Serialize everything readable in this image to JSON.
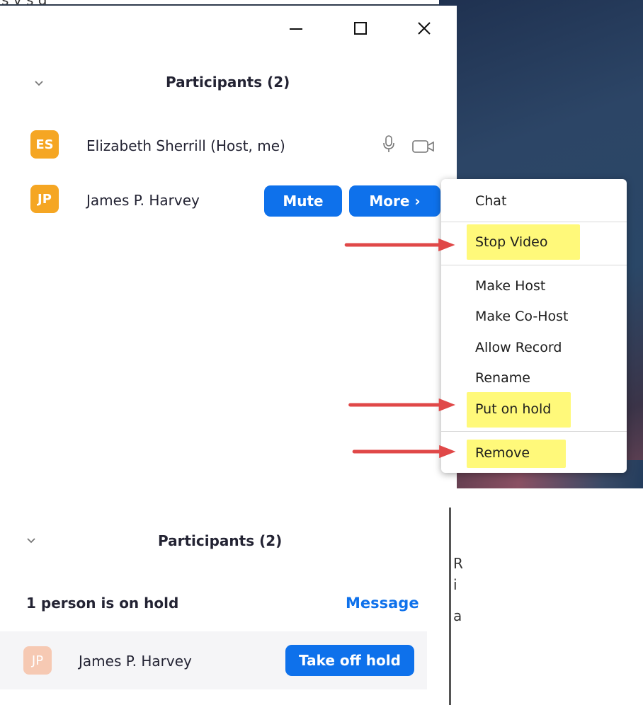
{
  "caption_fragment": "s   y  s  g",
  "window_controls": {
    "minimize_glyph": "—",
    "maximize_glyph": "☐",
    "close_glyph": "✕"
  },
  "participants_panel": {
    "title": "Participants (2)",
    "participants": [
      {
        "initials": "ES",
        "name": "Elizabeth Sherrill (Host, me)",
        "avatar_color": "#f5a623",
        "icons": [
          "microphone-icon",
          "video-camera-icon"
        ]
      },
      {
        "initials": "JP",
        "name": "James P. Harvey",
        "avatar_color": "#f5a623",
        "mute_label": "Mute",
        "more_label": "More ›"
      }
    ]
  },
  "context_menu": {
    "items": [
      {
        "label": "Chat",
        "highlighted": false
      },
      {
        "label": "Stop Video",
        "highlighted": true
      },
      {
        "label": "Make Host",
        "highlighted": false
      },
      {
        "label": "Make Co-Host",
        "highlighted": false
      },
      {
        "label": "Allow Record",
        "highlighted": false
      },
      {
        "label": "Rename",
        "highlighted": false
      },
      {
        "label": "Put on hold",
        "highlighted": true
      },
      {
        "label": "Remove",
        "highlighted": true
      }
    ],
    "highlight_color": "#fff97a",
    "arrow_color": "#e04848"
  },
  "hold_panel": {
    "title": "Participants (2)",
    "hold_text": "1 person is on hold",
    "message_label": "Message",
    "participant": {
      "initials": "JP",
      "name": "James P. Harvey",
      "avatar_color": "#f6c9b3",
      "take_off_hold_label": "Take off hold"
    },
    "right_fragments": [
      "R",
      "i",
      "a"
    ]
  },
  "colors": {
    "accent_blue": "#0e71eb",
    "text_dark": "#232333"
  }
}
